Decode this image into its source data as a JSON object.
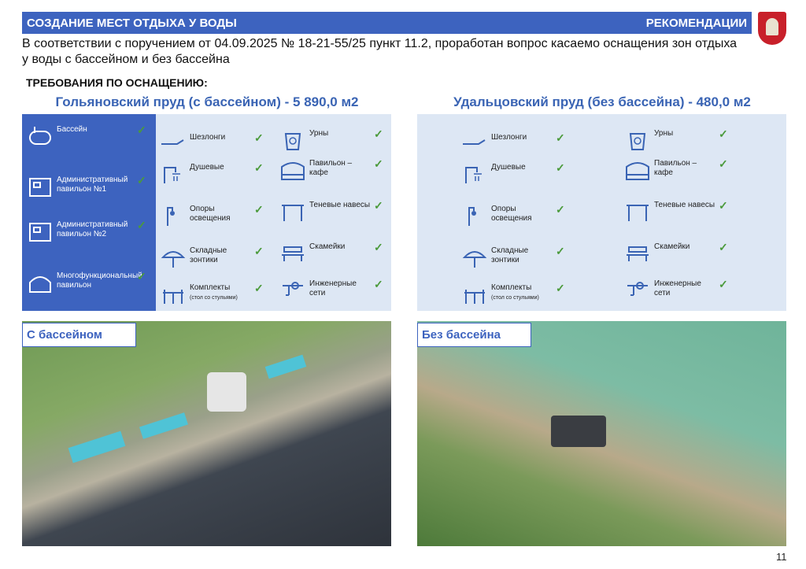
{
  "header": {
    "title": "СОЗДАНИЕ МЕСТ ОТДЫХА У ВОДЫ",
    "section": "РЕКОМЕНДАЦИИ"
  },
  "intro": "В соответствии с поручением от 04.09.2025 № 18-21-55/25 пункт 11.2, проработан вопрос касаемо оснащения зон отдыха у воды с бассейном и без бассейна",
  "requirements_title": "ТРЕБОВАНИЯ ПО ОСНАЩЕНИЮ:",
  "left": {
    "title": "Гольяновский пруд (с бассейном) - 5 890,0 м2",
    "pool_items": [
      "Бассейн",
      "Административный павильон №1",
      "Административный павильон №2",
      "Многофункциональный павильон"
    ],
    "col1": [
      "Шезлонги",
      "Душевые",
      "Опоры освещения",
      "Складные зонтики",
      "Комплекты"
    ],
    "col2": [
      "Урны",
      "Павильон – кафе",
      "Теневые навесы",
      "Скамейки",
      "Инженерные сети"
    ],
    "kit_note": "(стол со стульями)",
    "photo_label": "С бассейном"
  },
  "right": {
    "title": "Удальцовский пруд (без бассейна) - 480,0 м2",
    "col1": [
      "Шезлонги",
      "Душевые",
      "Опоры освещения",
      "Складные зонтики",
      "Комплекты"
    ],
    "col2": [
      "Урны",
      "Павильон – кафе",
      "Теневые навесы",
      "Скамейки",
      "Инженерные сети"
    ],
    "kit_note": "(стол со стульями)",
    "photo_label": "Без бассейна"
  },
  "check": "✓",
  "page_number": "11",
  "colors": {
    "brand": "#3d63bf",
    "panel": "#dde7f4",
    "check": "#4a9a3a"
  }
}
